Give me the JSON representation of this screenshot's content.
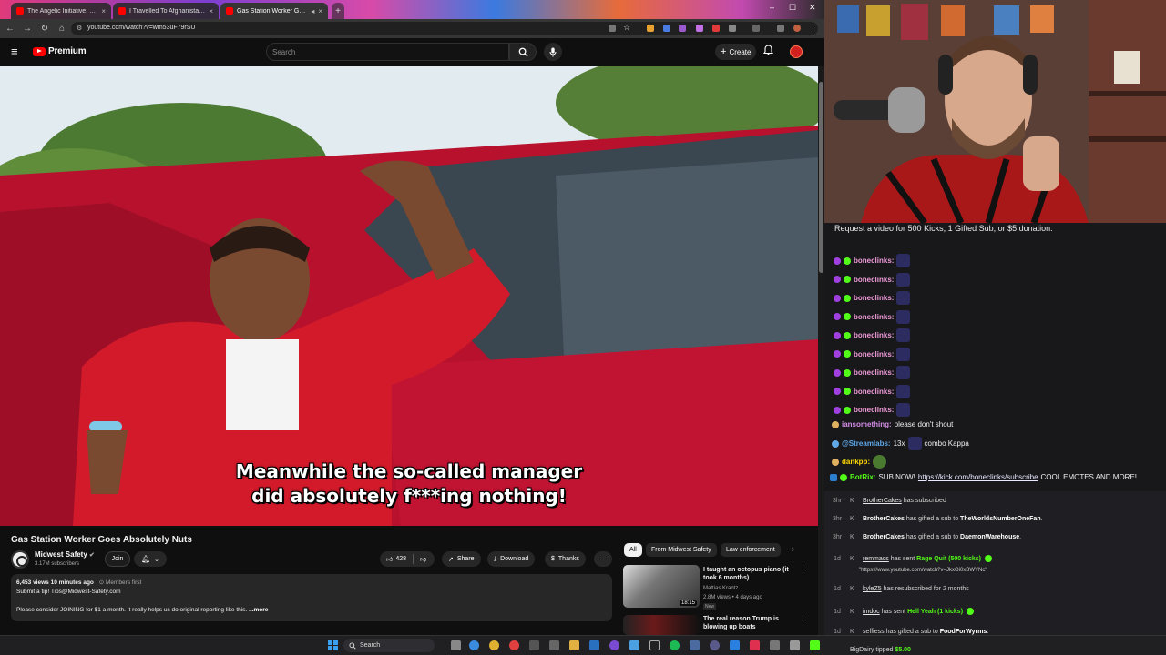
{
  "browser": {
    "tabs": [
      {
        "label": "The Angelic Initiative: Episode",
        "active": false
      },
      {
        "label": "I Travelled To Afghanistan... An",
        "active": false
      },
      {
        "label": "Gas Station Worker Goes A",
        "active": true
      }
    ],
    "url": "youtube.com/watch?v=wm53uF79rSU"
  },
  "youtube": {
    "logo_text": "Premium",
    "search_placeholder": "Search",
    "create_label": "Create",
    "video": {
      "title": "Gas Station Worker Goes Absolutely Nuts",
      "subtitle_line1": "Meanwhile the so-called manager",
      "subtitle_line2": "did absolutely f***ing nothing!",
      "channel": "Midwest Safety",
      "subscribers": "3.17M subscribers",
      "join_label": "Join",
      "likes": "428",
      "share_label": "Share",
      "download_label": "Download",
      "thanks_label": "Thanks",
      "desc_meta": "6,453 views  10 minutes ago",
      "desc_members": "Members first",
      "desc_line1": "Submit a tip! Tips@Midwest-Safety.com",
      "desc_line2": "Please consider JOINING for $1 a month. It really helps us do original reporting like this.",
      "more_label": "...more"
    },
    "chips": [
      "All",
      "From Midwest Safety",
      "Law enforcement"
    ],
    "related": [
      {
        "title": "I taught an octopus piano (it took 6 months)",
        "channel": "Mattias Krantz",
        "meta": "2.8M views • 4 days ago",
        "badge": "New",
        "duration": "18:15"
      },
      {
        "title": "The real reason Trump is blowing up boats",
        "channel": "",
        "meta": "",
        "badge": "",
        "duration": ""
      }
    ]
  },
  "chat": {
    "banner": "Request a video for 500 Kicks, 1 Gifted Sub, or $5 donation.",
    "spam_user": "boneclinks:",
    "spam_count": 9,
    "messages": [
      {
        "user": "iansomething:",
        "text": "please don't shout",
        "color": "#d68fe8"
      },
      {
        "user": "@Streamlabs:",
        "text": "13x",
        "extra": "combo Kappa",
        "color": "#5fa8e8"
      },
      {
        "user": "dankpp:",
        "text": "",
        "color": "#ffd700"
      },
      {
        "user": "BotRix:",
        "text": "SUB NOW!",
        "link": "https://kick.com/boneclinks/subscribe",
        "tail": "COOL EMOTES AND MORE!",
        "color": "#53fc18"
      }
    ],
    "events": [
      {
        "time": "3hr",
        "user": "BrotherCakes",
        "action": "has subscribed",
        "target": "",
        "suffix": ""
      },
      {
        "time": "3hr",
        "user": "BrotherCakes",
        "action": "has gifted a sub to",
        "target": "TheWorldsNumberOneFan",
        "suffix": "."
      },
      {
        "time": "3hr",
        "user": "BrotherCakes",
        "action": "has gifted a sub to",
        "target": "DaemonWarehouse",
        "suffix": "."
      },
      {
        "time": "1d",
        "user": "remmacs",
        "action": "has sent",
        "target": "Rage Quit (500 kicks)",
        "suffix": "",
        "sub": "\"https://www.youtube.com/watch?v=JkxOi0xBWYNc\""
      },
      {
        "time": "1d",
        "user": "kyleZ5",
        "action": "has resubscribed for 2 months",
        "target": "",
        "suffix": ""
      },
      {
        "time": "1d",
        "user": "imdoc",
        "action": "has sent",
        "target": "Hell Yeah (1 kicks)",
        "suffix": ""
      },
      {
        "time": "1d",
        "user": "seffiess",
        "action": "has gifted a sub to",
        "target": "FoodForWyrms",
        "suffix": "."
      },
      {
        "time": "",
        "user": "BigDairy",
        "action": "tipped",
        "target": "$5.00",
        "suffix": ""
      }
    ]
  },
  "taskbar": {
    "search_label": "Search"
  },
  "colors": {
    "yt_red": "#ff0000",
    "kick_green": "#53fc18",
    "chat_bg": "#18181b"
  }
}
